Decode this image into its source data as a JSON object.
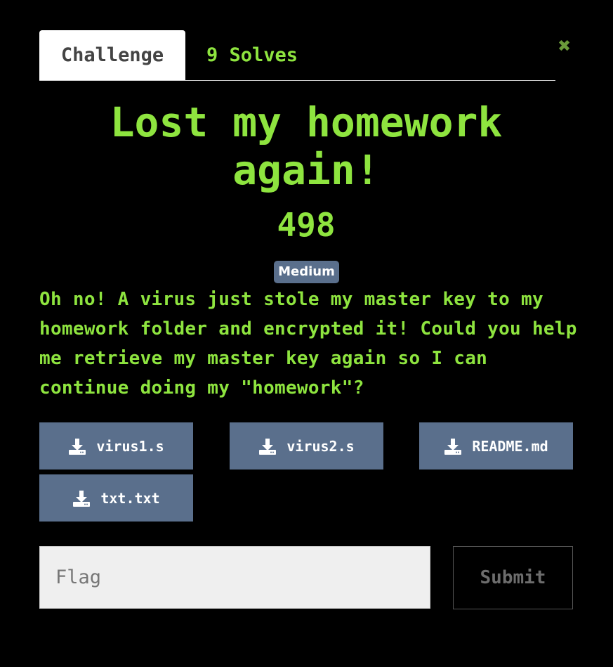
{
  "tabs": {
    "challenge": "Challenge",
    "solves": "9 Solves"
  },
  "close_icon": "close-icon",
  "challenge": {
    "title": "Lost my homework again!",
    "points": "498",
    "difficulty": "Medium",
    "description": "Oh no! A virus just stole my master key to my homework folder and encrypted it! Could you help me retrieve my master key again so I can continue doing my \"homework\"?"
  },
  "files": [
    {
      "name": "virus1.s",
      "icon": "download-icon"
    },
    {
      "name": "virus2.s",
      "icon": "download-icon"
    },
    {
      "name": "README.md",
      "icon": "download-icon"
    },
    {
      "name": "txt.txt",
      "icon": "download-icon"
    }
  ],
  "submission": {
    "placeholder": "Flag",
    "value": "",
    "submit_label": "Submit"
  },
  "colors": {
    "background": "#000000",
    "accent_green": "#8ee43f",
    "badge_and_button": "#5a6f8c",
    "close_icon": "#6a9a3a"
  }
}
